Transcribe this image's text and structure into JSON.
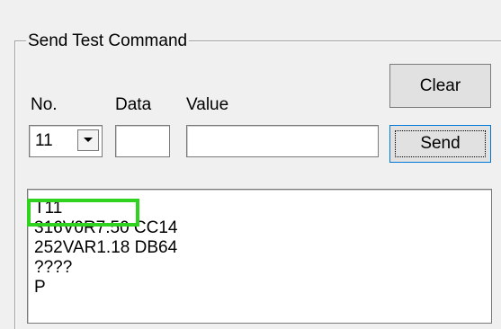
{
  "group": {
    "title": "Send Test Command"
  },
  "labels": {
    "no": "No.",
    "data": "Data",
    "value": "Value"
  },
  "buttons": {
    "clear": "Clear",
    "send": "Send"
  },
  "fields": {
    "no": "11",
    "data": "",
    "value": ""
  },
  "output": [
    "T11",
    "316V0R7.50 CC14",
    "252VAR1.18 DB64",
    "????",
    "P"
  ],
  "colors": {
    "highlight": "#2fd21f",
    "send_focus": "#0078d7"
  },
  "icons": {
    "dropdown": "chevron-down-icon"
  }
}
